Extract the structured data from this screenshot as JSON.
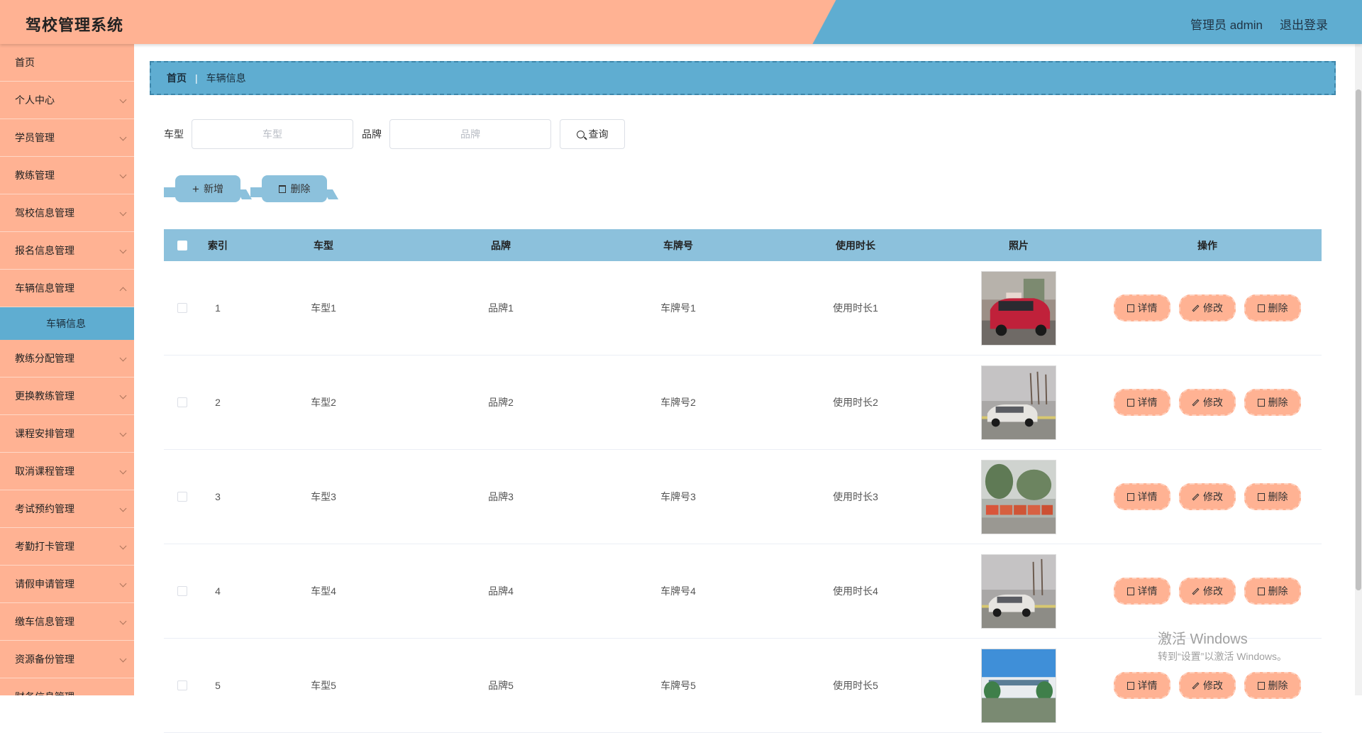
{
  "header": {
    "title": "驾校管理系统",
    "user": "管理员 admin",
    "logout": "退出登录"
  },
  "sidebar": {
    "items": [
      {
        "label": "首页",
        "has_chevron": false
      },
      {
        "label": "个人中心",
        "has_chevron": true
      },
      {
        "label": "学员管理",
        "has_chevron": true
      },
      {
        "label": "教练管理",
        "has_chevron": true
      },
      {
        "label": "驾校信息管理",
        "has_chevron": true
      },
      {
        "label": "报名信息管理",
        "has_chevron": true
      },
      {
        "label": "车辆信息管理",
        "has_chevron": true
      }
    ],
    "active_sub": "车辆信息",
    "items_after": [
      {
        "label": "教练分配管理"
      },
      {
        "label": "更换教练管理"
      },
      {
        "label": "课程安排管理"
      },
      {
        "label": "取消课程管理"
      },
      {
        "label": "考试预约管理"
      },
      {
        "label": "考勤打卡管理"
      },
      {
        "label": "请假申请管理"
      },
      {
        "label": "缴车信息管理"
      },
      {
        "label": "资源备份管理"
      },
      {
        "label": "财务信息管理"
      }
    ]
  },
  "breadcrumb": {
    "home": "首页",
    "current": "车辆信息"
  },
  "search": {
    "type_label": "车型",
    "type_placeholder": "车型",
    "brand_label": "品牌",
    "brand_placeholder": "品牌",
    "query_label": "查询"
  },
  "actions": {
    "add_label": "新增",
    "delete_label": "删除"
  },
  "table": {
    "headers": {
      "index": "索引",
      "type": "车型",
      "brand": "品牌",
      "plate": "车牌号",
      "duration": "使用时长",
      "photo": "照片",
      "ops": "操作"
    },
    "rows": [
      {
        "index": "1",
        "type": "车型1",
        "brand": "品牌1",
        "plate": "车牌号1",
        "duration": "使用时长1"
      },
      {
        "index": "2",
        "type": "车型2",
        "brand": "品牌2",
        "plate": "车牌号2",
        "duration": "使用时长2"
      },
      {
        "index": "3",
        "type": "车型3",
        "brand": "品牌3",
        "plate": "车牌号3",
        "duration": "使用时长3"
      },
      {
        "index": "4",
        "type": "车型4",
        "brand": "品牌4",
        "plate": "车牌号4",
        "duration": "使用时长4"
      },
      {
        "index": "5",
        "type": "车型5",
        "brand": "品牌5",
        "plate": "车牌号5",
        "duration": "使用时长5"
      }
    ],
    "op_labels": {
      "detail": "详情",
      "edit": "修改",
      "delete": "删除"
    }
  },
  "watermark": {
    "line1": "激活 Windows",
    "line2": "转到“设置”以激活 Windows。"
  },
  "colors": {
    "accent_peach": "#ffb293",
    "accent_blue": "#5fadd1",
    "table_header": "#8cc1dc"
  }
}
